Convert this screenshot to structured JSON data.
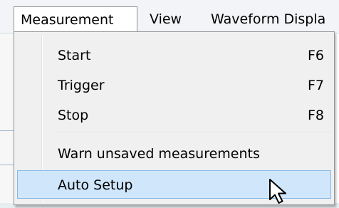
{
  "menubar": {
    "items": [
      {
        "label": "Measurement"
      },
      {
        "label": "View"
      },
      {
        "label": "Waveform Displa"
      }
    ]
  },
  "menu": {
    "items": [
      {
        "label": "Start",
        "shortcut": "F6"
      },
      {
        "label": "Trigger",
        "shortcut": "F7"
      },
      {
        "label": "Stop",
        "shortcut": "F8"
      },
      {
        "label": "Warn unsaved measurements",
        "shortcut": ""
      },
      {
        "label": "Auto Setup",
        "shortcut": "",
        "highlighted": true
      }
    ]
  },
  "colors": {
    "menubar_bg": "#f2f4f7",
    "menu_bg": "#f0f0f0",
    "highlight_bg": "#cfe6fb",
    "highlight_border": "#86b9e6"
  }
}
